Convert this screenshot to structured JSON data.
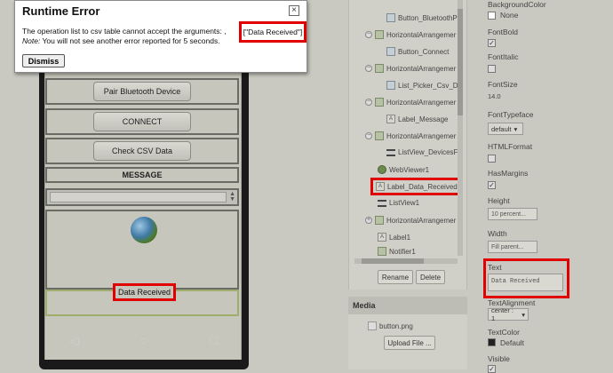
{
  "dialog": {
    "title": "Runtime Error",
    "close_label": "×",
    "message_prefix": "The operation list to csv table cannot accept the arguments: ,",
    "message_arg": "[\"Data Received\"]",
    "note_label": "Note:",
    "note_text": " You will not see another error reported for 5 seconds.",
    "dismiss_label": "Dismiss"
  },
  "viewer": {
    "buttons": [
      "Pair Bluetooth Device",
      "CONNECT",
      "Check CSV Data"
    ],
    "message_label": "MESSAGE",
    "data_received_label": "Data Received",
    "nav": {
      "back": "◁",
      "home": "○",
      "recent": "□"
    }
  },
  "components": {
    "nodes": [
      {
        "name": "Button_BluetoothPa"
      },
      {
        "name": "HorizontalArrangemer"
      },
      {
        "name": "Button_Connect"
      },
      {
        "name": "HorizontalArrangemer"
      },
      {
        "name": "List_Picker_Csv_Da"
      },
      {
        "name": "HorizontalArrangemer"
      },
      {
        "name": "Label_Message"
      },
      {
        "name": "HorizontalArrangemer"
      },
      {
        "name": "ListView_DevicesFo"
      },
      {
        "name": "WebViewer1"
      },
      {
        "name": "Label_Data_Received"
      },
      {
        "name": "ListView1"
      },
      {
        "name": "HorizontalArrangemer"
      },
      {
        "name": "Label1"
      },
      {
        "name": "Notifier1"
      }
    ],
    "rename_label": "Rename",
    "delete_label": "Delete"
  },
  "media": {
    "header": "Media",
    "file": "button.png",
    "upload_label": "Upload File ..."
  },
  "properties": {
    "background_color_label": "BackgroundColor",
    "background_color_value": "None",
    "font_bold_label": "FontBold",
    "font_italic_label": "FontItalic",
    "font_size_label": "FontSize",
    "font_size_value": "14.0",
    "font_typeface_label": "FontTypeface",
    "font_typeface_value": "default",
    "html_format_label": "HTMLFormat",
    "has_margins_label": "HasMargins",
    "height_label": "Height",
    "height_value": "10 percent...",
    "width_label": "Width",
    "width_value": "Fill parent...",
    "text_label": "Text",
    "text_value": "Data Received",
    "text_alignment_label": "TextAlignment",
    "text_alignment_value": "center : 1",
    "text_color_label": "TextColor",
    "text_color_value": "Default",
    "visible_label": "Visible",
    "checkmark": "✓",
    "dropdown_arrow": "▾"
  },
  "colors": {
    "highlight": "#e00000",
    "text_color_swatch": "#222222"
  }
}
